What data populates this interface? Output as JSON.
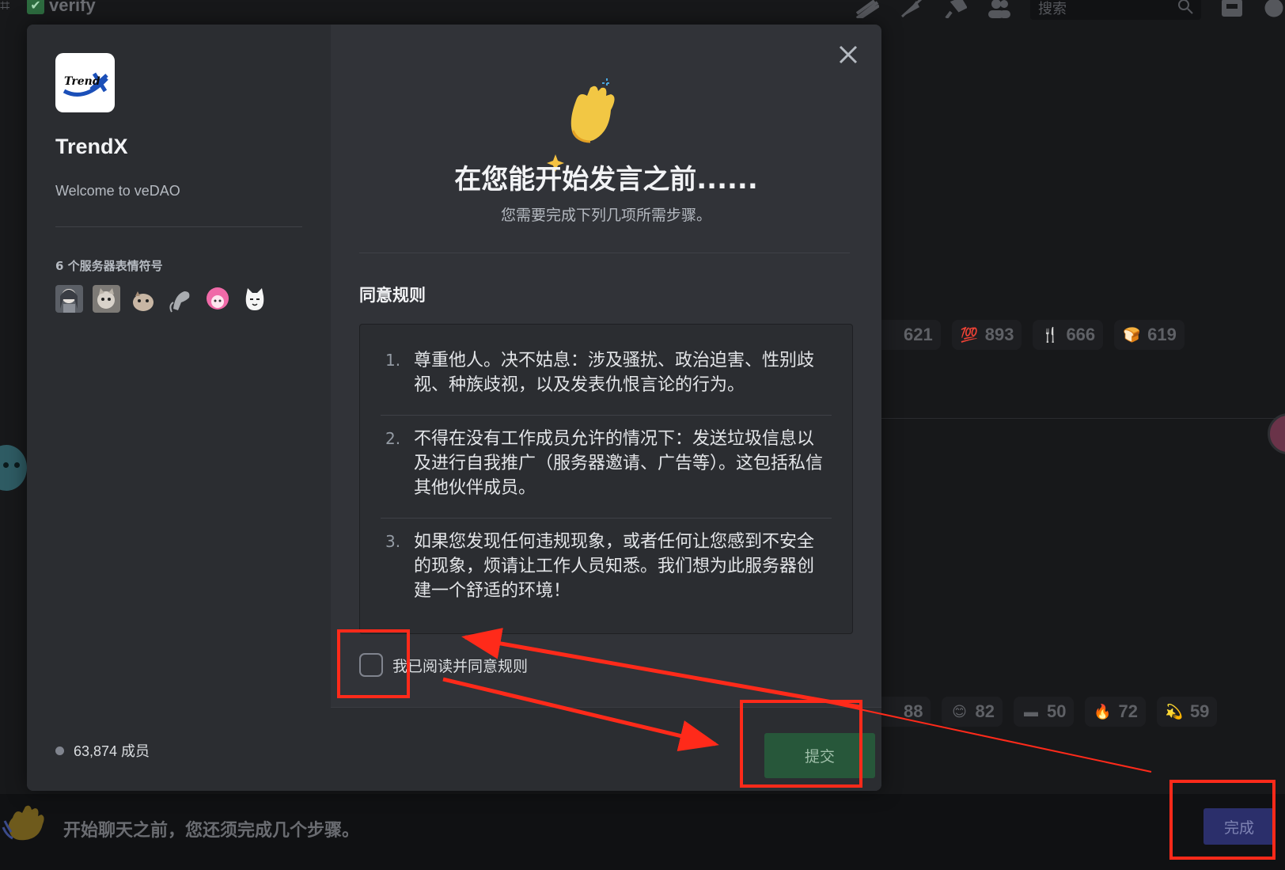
{
  "background": {
    "channel_name": "verify",
    "search_placeholder": "搜索",
    "reactions_row1": [
      {
        "icon": "partial-emoji-icon",
        "count": "621"
      },
      {
        "icon": "hundred-points-icon",
        "count": "893"
      },
      {
        "icon": "fork-knife-icon",
        "count": "666"
      },
      {
        "icon": "bread-icon",
        "count": "619"
      }
    ],
    "reactions_row2": [
      {
        "icon": "partial-emoji-icon",
        "count": "88"
      },
      {
        "icon": "smiling-face-icon",
        "count": "82"
      },
      {
        "icon": "india-flag-icon",
        "count": "50"
      },
      {
        "icon": "fire-icon",
        "count": "72"
      },
      {
        "icon": "dizzy-icon",
        "count": "59"
      }
    ]
  },
  "server": {
    "logo_text": "Trend",
    "name": "TrendX",
    "description": "Welcome to veDAO",
    "emoji_heading": "6 个服务器表情符号",
    "emojis": [
      "anime-girl-emoji",
      "cat-photo-emoji",
      "hamster-emoji",
      "rat-emoji",
      "pink-hair-emoji",
      "white-cat-emoji"
    ],
    "member_count": "63,874 成员"
  },
  "modal": {
    "title": "在您能开始发言之前......",
    "subtitle": "您需要完成下列几项所需步骤。",
    "section_title": "同意规则",
    "rules": [
      {
        "number": "1.",
        "text": "尊重他人。决不姑息：涉及骚扰、政治迫害、性别歧视、种族歧视，以及发表仇恨言论的行为。"
      },
      {
        "number": "2.",
        "text": "不得在没有工作成员允许的情况下：发送垃圾信息以及进行自我推广（服务器邀请、广告等）。这包括私信其他伙伴成员。"
      },
      {
        "number": "3.",
        "text": "如果您发现任何违规现象，或者任何让您感到不安全的现象，烦请让工作人员知悉。我们想为此服务器创建一个舒适的环境！"
      }
    ],
    "agree_label": "我已阅读并同意规则",
    "submit_label": "提交"
  },
  "bottom_bar": {
    "message": "开始聊天之前，您还须完成几个步骤。",
    "done_label": "完成"
  },
  "colors": {
    "modal_bg": "#313338",
    "sidebar_bg": "#2b2d31",
    "submit_green": "#27573a",
    "done_blurple": "#2b2f6b",
    "annotation_red": "#ff2a1a"
  }
}
